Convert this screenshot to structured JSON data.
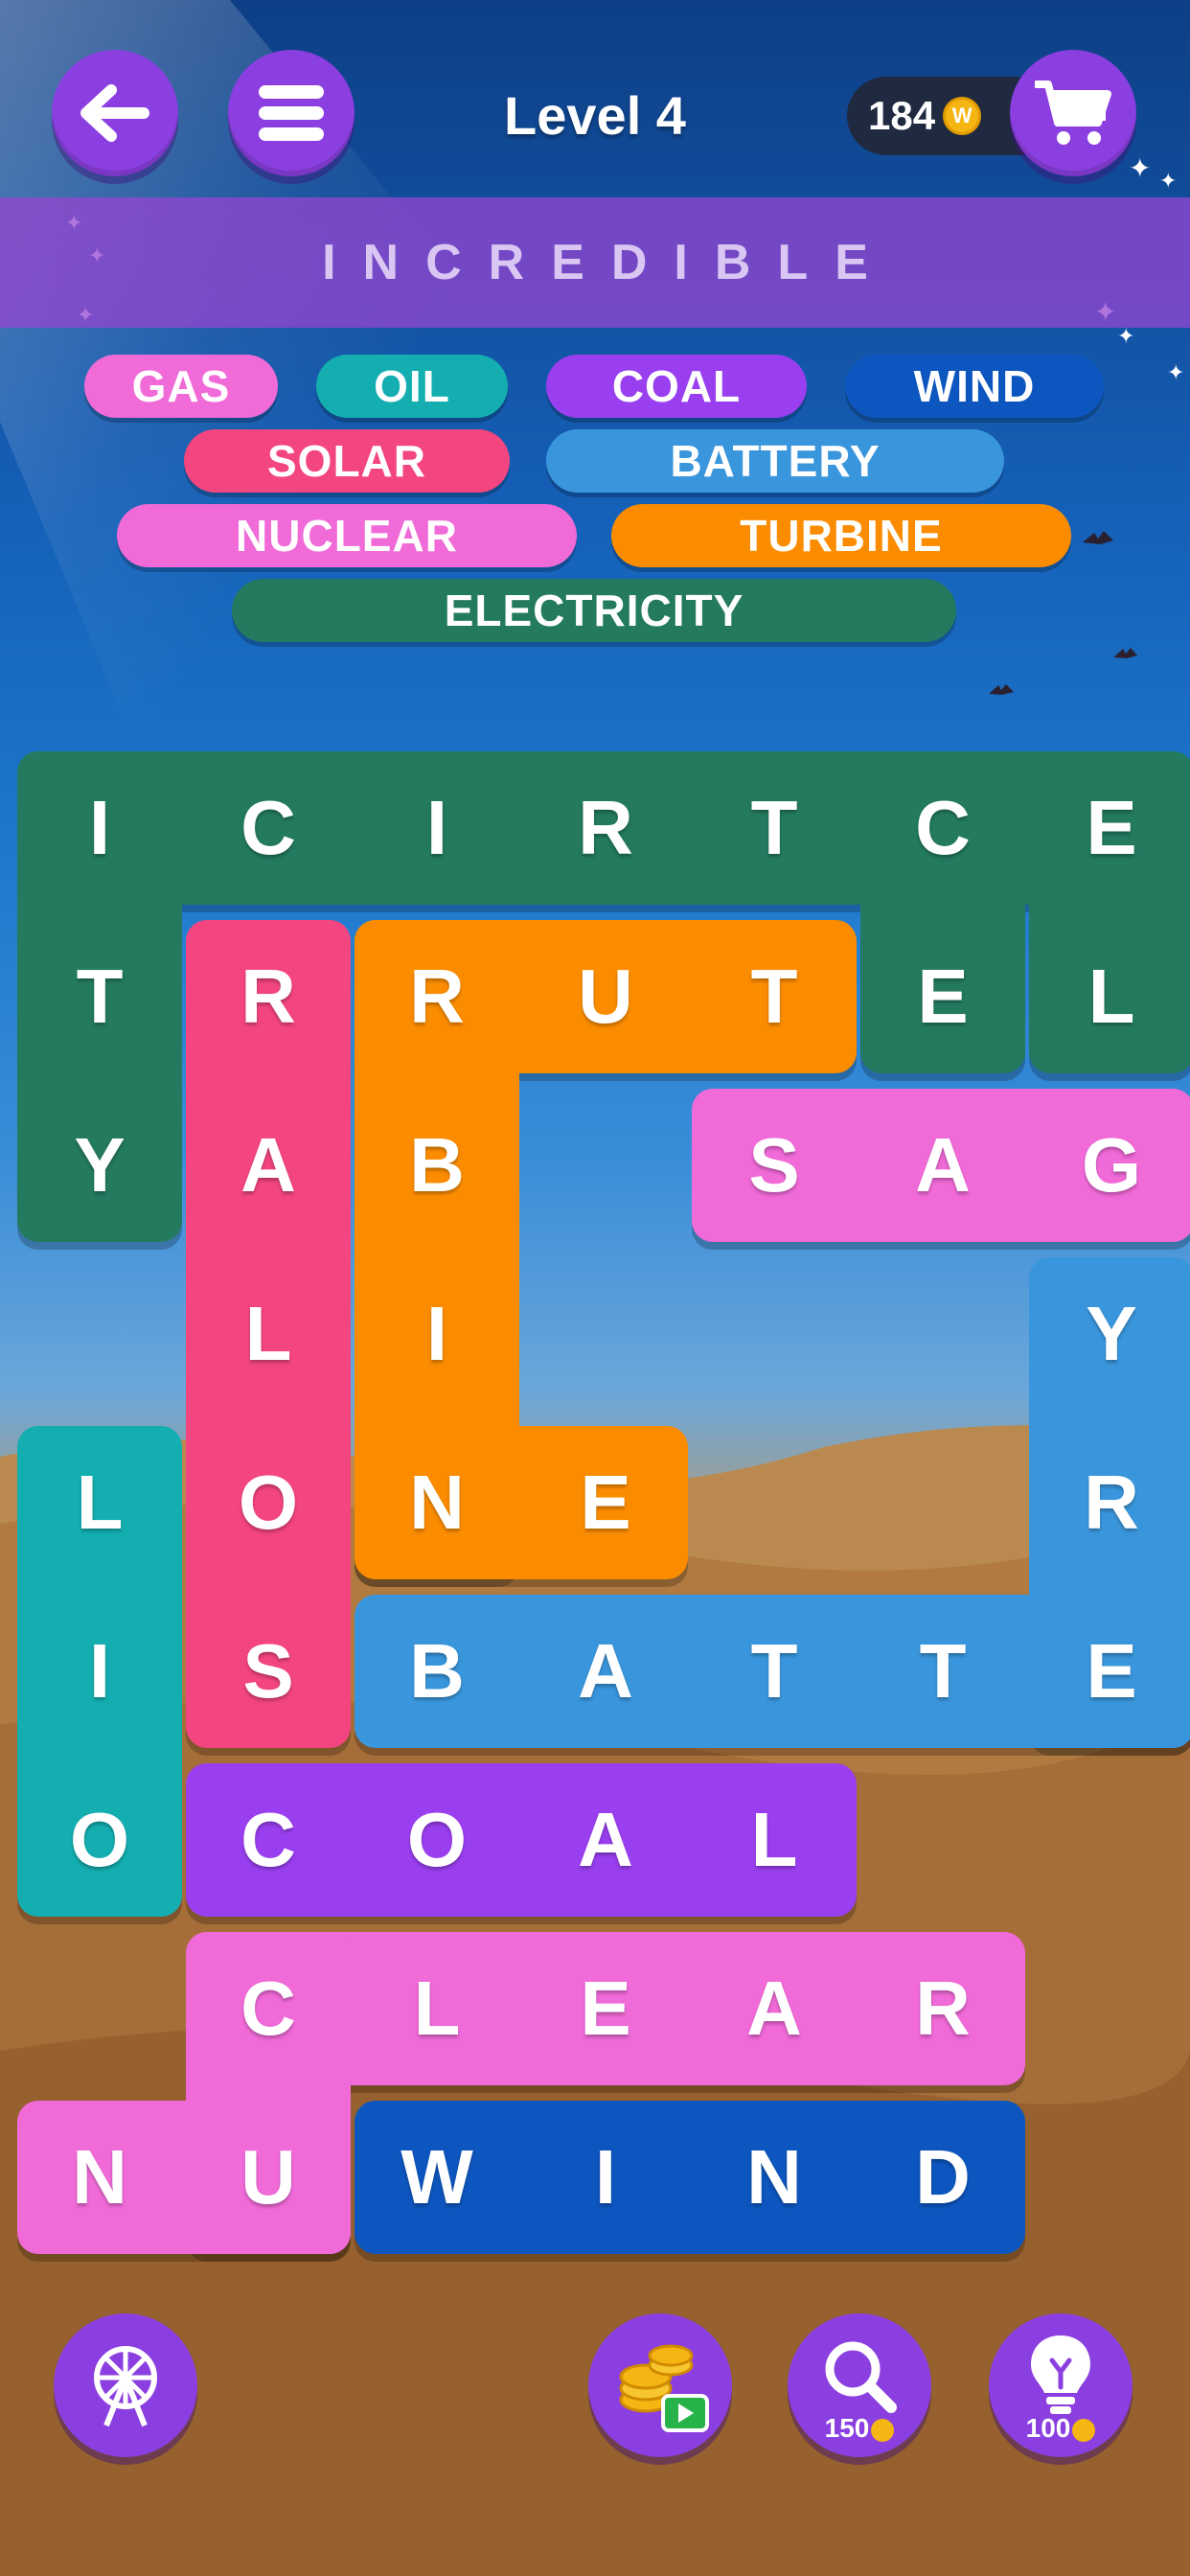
{
  "header": {
    "title": "Level 4",
    "coins": "184",
    "coin_symbol": "W"
  },
  "banner": {
    "text": "INCREDIBLE"
  },
  "found_words": [
    {
      "label": "GAS",
      "color": "#f06ad8"
    },
    {
      "label": "OIL",
      "color": "#14aeb0"
    },
    {
      "label": "COAL",
      "color": "#9a3ff0"
    },
    {
      "label": "WIND",
      "color": "#0d56bf"
    },
    {
      "label": "SOLAR",
      "color": "#f3457f"
    },
    {
      "label": "BATTERY",
      "color": "#3a96dc"
    },
    {
      "label": "NUCLEAR",
      "color": "#f06ad8"
    },
    {
      "label": "TURBINE",
      "color": "#fb8c00"
    },
    {
      "label": "ELECTRICITY",
      "color": "#237a5f"
    }
  ],
  "grid": {
    "rows": [
      [
        "I",
        "C",
        "I",
        "R",
        "T",
        "C",
        "E"
      ],
      [
        "T",
        "R",
        "R",
        "U",
        "T",
        "E",
        "L"
      ],
      [
        "Y",
        "A",
        "B",
        "",
        "S",
        "A",
        "G"
      ],
      [
        "",
        "L",
        "I",
        "",
        "",
        "",
        "Y"
      ],
      [
        "L",
        "O",
        "N",
        "E",
        "",
        "",
        "R"
      ],
      [
        "I",
        "S",
        "B",
        "A",
        "T",
        "T",
        "E"
      ],
      [
        "O",
        "C",
        "O",
        "A",
        "L",
        "",
        ""
      ],
      [
        "",
        "C",
        "L",
        "E",
        "A",
        "R",
        ""
      ],
      [
        "N",
        "U",
        "W",
        "I",
        "N",
        "D",
        ""
      ]
    ]
  },
  "tools": {
    "shuffle_icon": "ferris-wheel-icon",
    "video_icon": "coins-video-icon",
    "search_cost": "150",
    "hint_cost": "100"
  },
  "colors": {
    "button_purple": "#8b3fe0",
    "banner_purple": "#9646d2"
  }
}
